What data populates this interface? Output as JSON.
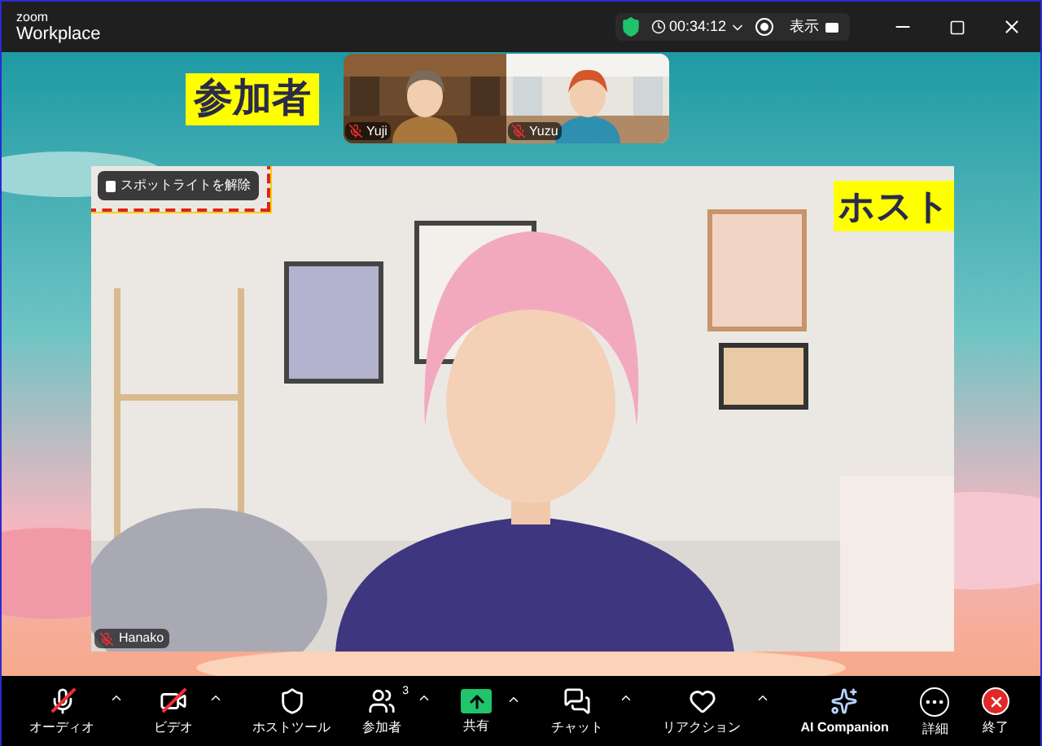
{
  "window": {
    "brand_top": "zoom",
    "brand": "Workplace",
    "timer": "00:34:12",
    "view_button": "表示"
  },
  "annotations": [
    {
      "text": "参加者"
    },
    {
      "text": "ホスト"
    }
  ],
  "thumbnails": [
    {
      "name": "Yuji",
      "muted": true,
      "kind": "man"
    },
    {
      "name": "Yuzu",
      "muted": true,
      "kind": "woman"
    }
  ],
  "main_video": {
    "name": "Hanako",
    "muted": true,
    "spotlight_button": "スポットライトを解除",
    "highlighted": true
  },
  "toolbar": [
    {
      "kind": "audio",
      "label": "オーディオ",
      "off": true,
      "caret": true
    },
    {
      "kind": "video",
      "label": "ビデオ",
      "off": true,
      "caret": true
    },
    {
      "kind": "host",
      "label": "ホストツール",
      "caret": false
    },
    {
      "kind": "participants",
      "label": "参加者",
      "count": "3",
      "caret": true
    },
    {
      "kind": "share",
      "label": "共有",
      "caret": true
    },
    {
      "kind": "chat",
      "label": "チャット",
      "caret": true
    },
    {
      "kind": "reaction",
      "label": "リアクション",
      "caret": true
    },
    {
      "kind": "ai",
      "label": "AI Companion",
      "caret": false
    },
    {
      "kind": "more",
      "label": "詳細",
      "caret": false
    },
    {
      "kind": "end",
      "label": "終了",
      "caret": false
    }
  ]
}
